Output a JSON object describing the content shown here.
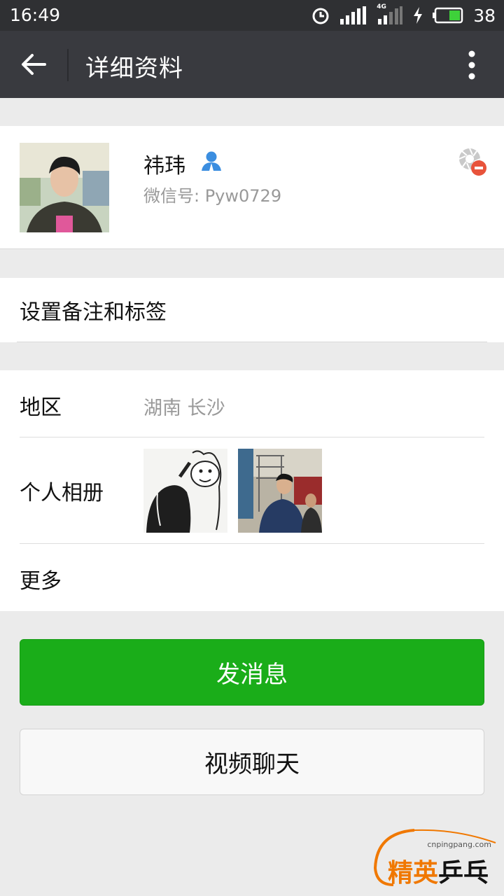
{
  "status_bar": {
    "time": "16:49",
    "network": "4G",
    "battery_level": "38"
  },
  "header": {
    "title": "详细资料"
  },
  "profile": {
    "name": "祎玮",
    "wechat_id": "微信号: Pyw0729"
  },
  "remark": {
    "label": "设置备注和标签"
  },
  "info": {
    "region_label": "地区",
    "region_value": "湖南  长沙",
    "album_label": "个人相册",
    "more_label": "更多"
  },
  "actions": {
    "send_message": "发消息",
    "video_chat": "视频聊天"
  },
  "watermark": {
    "url": "cnpingpang.com",
    "text_a": "精英",
    "text_b": "乒乓网"
  },
  "colors": {
    "primary_green": "#1aad19",
    "title_bar": "#393a3f",
    "status_bar": "#2f3033",
    "contact_icon_blue": "#3b8ee0"
  }
}
